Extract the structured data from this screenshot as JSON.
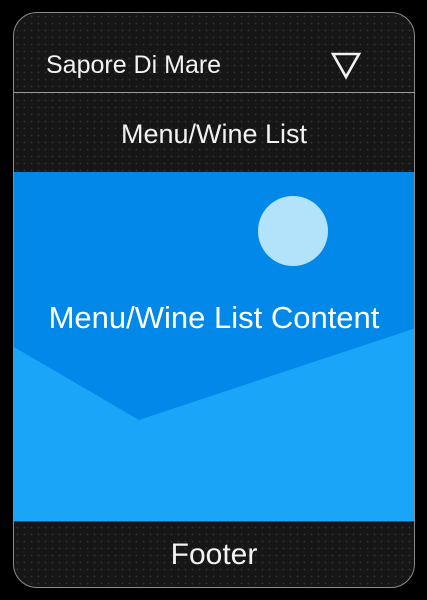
{
  "header": {
    "title": "Sapore Di Mare",
    "dropdown_icon": "triangle-down-icon"
  },
  "subheader": {
    "title": "Menu/Wine List"
  },
  "content": {
    "label": "Menu/Wine List Content",
    "placeholder_icon": "image-placeholder-icon"
  },
  "footer": {
    "label": "Footer"
  },
  "colors": {
    "background": "#161616",
    "content_dark": "#0288e8",
    "content_light": "#1aa6f8",
    "sun": "#b3e3fb",
    "border": "#8a8a8a"
  }
}
